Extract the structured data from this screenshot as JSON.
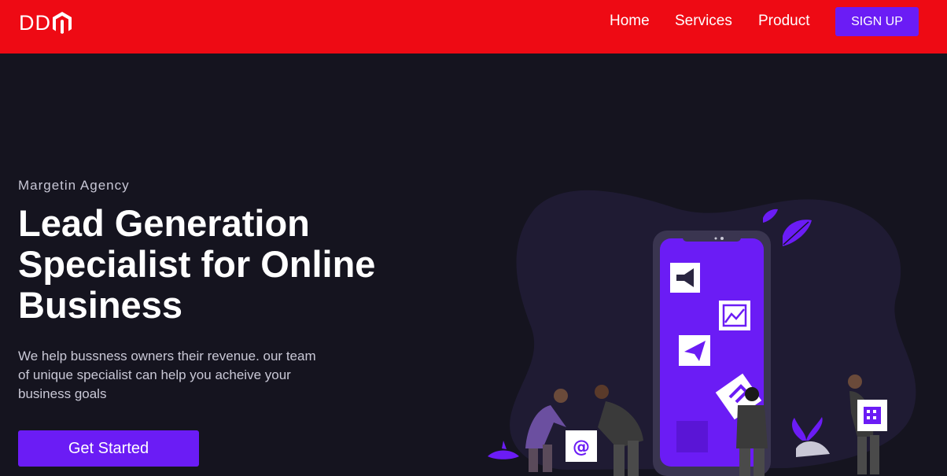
{
  "nav": {
    "logo_text": "DD",
    "links": [
      "Home",
      "Services",
      "Product"
    ],
    "signup_label": "SIGN UP"
  },
  "hero": {
    "eyebrow": "Margetin Agency",
    "headline": "Lead Generation Specialist for Online Business",
    "subtext": "We help bussness owners their revenue. our team of unique specialist can help you acheive your business goals",
    "cta_label": "Get Started"
  },
  "colors": {
    "navbar": "#ee0a14",
    "background": "#15141f",
    "accent": "#6b1cf5",
    "blob": "#1f1b33"
  },
  "icons": [
    "magento-logo-icon",
    "megaphone-icon",
    "chart-icon",
    "paper-plane-icon",
    "email-at-icon",
    "building-icon",
    "leaf-icon"
  ]
}
